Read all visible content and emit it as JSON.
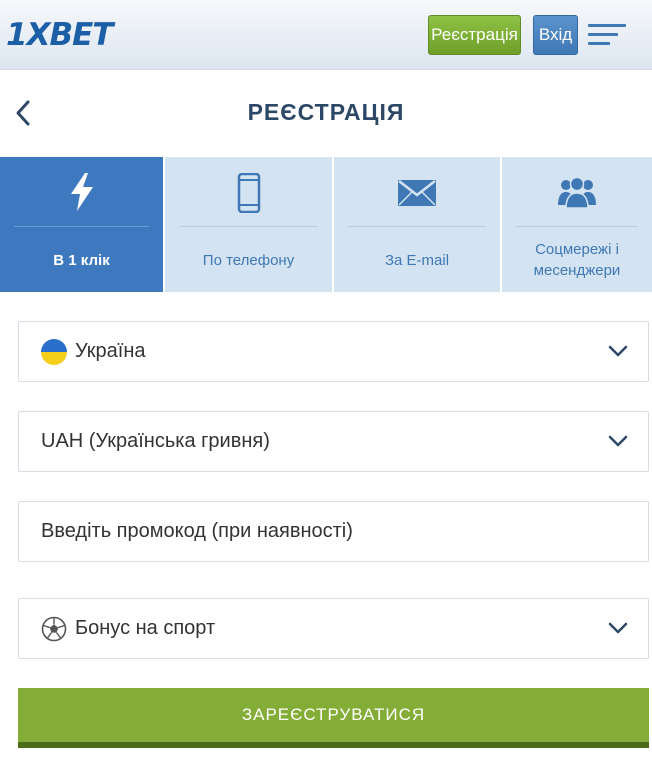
{
  "header": {
    "logo": "1XBET",
    "register_label": "Реєстрація",
    "login_label": "Вхід"
  },
  "page": {
    "title": "РЕЄСТРАЦІЯ"
  },
  "tabs": [
    {
      "label": "В 1 клік",
      "icon": "lightning-icon",
      "active": true
    },
    {
      "label": "По телефону",
      "icon": "phone-icon",
      "active": false
    },
    {
      "label": "За E-mail",
      "icon": "envelope-icon",
      "active": false
    },
    {
      "label": "Соцмережі і месенджери",
      "icon": "users-icon",
      "active": false
    }
  ],
  "form": {
    "country": {
      "value": "Україна",
      "icon": "ukraine-flag-icon"
    },
    "currency": {
      "value": "UAH (Українська гривня)"
    },
    "promo": {
      "placeholder": "Введіть промокод (при наявності)"
    },
    "bonus": {
      "value": "Бонус на спорт",
      "icon": "soccer-ball-icon"
    },
    "submit_label": "ЗАРЕЄСТРУВАТИСЯ"
  },
  "colors": {
    "brand_blue": "#1c5fa6",
    "active_tab": "#3e79bf",
    "inactive_tab": "#d4e3f1",
    "register_green": "#84ad37"
  }
}
